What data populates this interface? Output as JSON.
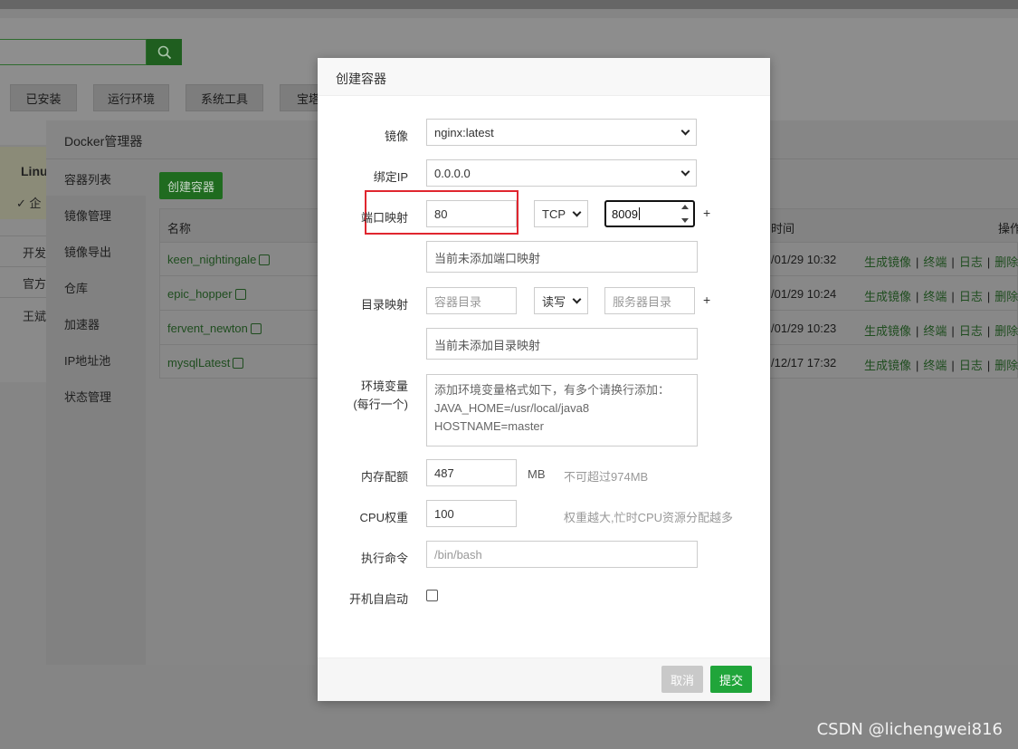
{
  "background": {
    "tabs": [
      "已安装",
      "运行环境",
      "系统工具",
      "宝塔"
    ],
    "left_list": {
      "box_title": "Linu",
      "box_sub": "✓ 企",
      "items": [
        "开发",
        "官方",
        "王斌"
      ]
    }
  },
  "docker": {
    "title": "Docker管理器",
    "side_items": [
      "容器列表",
      "镜像管理",
      "镜像导出",
      "仓库",
      "加速器",
      "IP地址池",
      "状态管理"
    ],
    "create_button": "创建容器",
    "table": {
      "col_name": "名称",
      "col_time": "时间",
      "col_ops": "操作",
      "rows": [
        {
          "name": "keen_nightingale",
          "time": "/01/29 10:32"
        },
        {
          "name": "epic_hopper",
          "time": "/01/29 10:24"
        },
        {
          "name": "fervent_newton",
          "time": "/01/29 10:23"
        },
        {
          "name": "mysqlLatest",
          "time": "/12/17 17:32"
        }
      ],
      "actions": [
        "生成镜像",
        "终端",
        "日志",
        "删除"
      ]
    }
  },
  "modal": {
    "title": "创建容器",
    "image_label": "镜像",
    "image_value": "nginx:latest",
    "bind_ip_label": "绑定IP",
    "bind_ip_value": "0.0.0.0",
    "port_label": "端口映射",
    "port_container": "80",
    "port_protocol": "TCP",
    "port_host": "8009",
    "port_empty": "当前未添加端口映射",
    "dir_label": "目录映射",
    "dir_container_placeholder": "容器目录",
    "dir_mode": "读写",
    "dir_host_placeholder": "服务器目录",
    "dir_empty": "当前未添加目录映射",
    "env_label": "环境变量",
    "env_label2": "(每行一个)",
    "env_placeholder_lines": [
      "添加环境变量格式如下，有多个请换行添加：",
      "JAVA_HOME=/usr/local/java8",
      "HOSTNAME=master"
    ],
    "mem_label": "内存配额",
    "mem_value": "487",
    "mem_unit": "MB",
    "mem_tip": "不可超过974MB",
    "cpu_label": "CPU权重",
    "cpu_value": "100",
    "cpu_tip": "权重越大,忙时CPU资源分配越多",
    "cmd_label": "执行命令",
    "cmd_placeholder": "/bin/bash",
    "autostart_label": "开机自启动",
    "plus": "+",
    "cancel": "取消",
    "submit": "提交"
  },
  "watermark": "CSDN @lichengwei816",
  "colors": {
    "primary_green": "#20a53a",
    "highlight_red": "#e0262f",
    "overlay": "#7a7a7a"
  }
}
